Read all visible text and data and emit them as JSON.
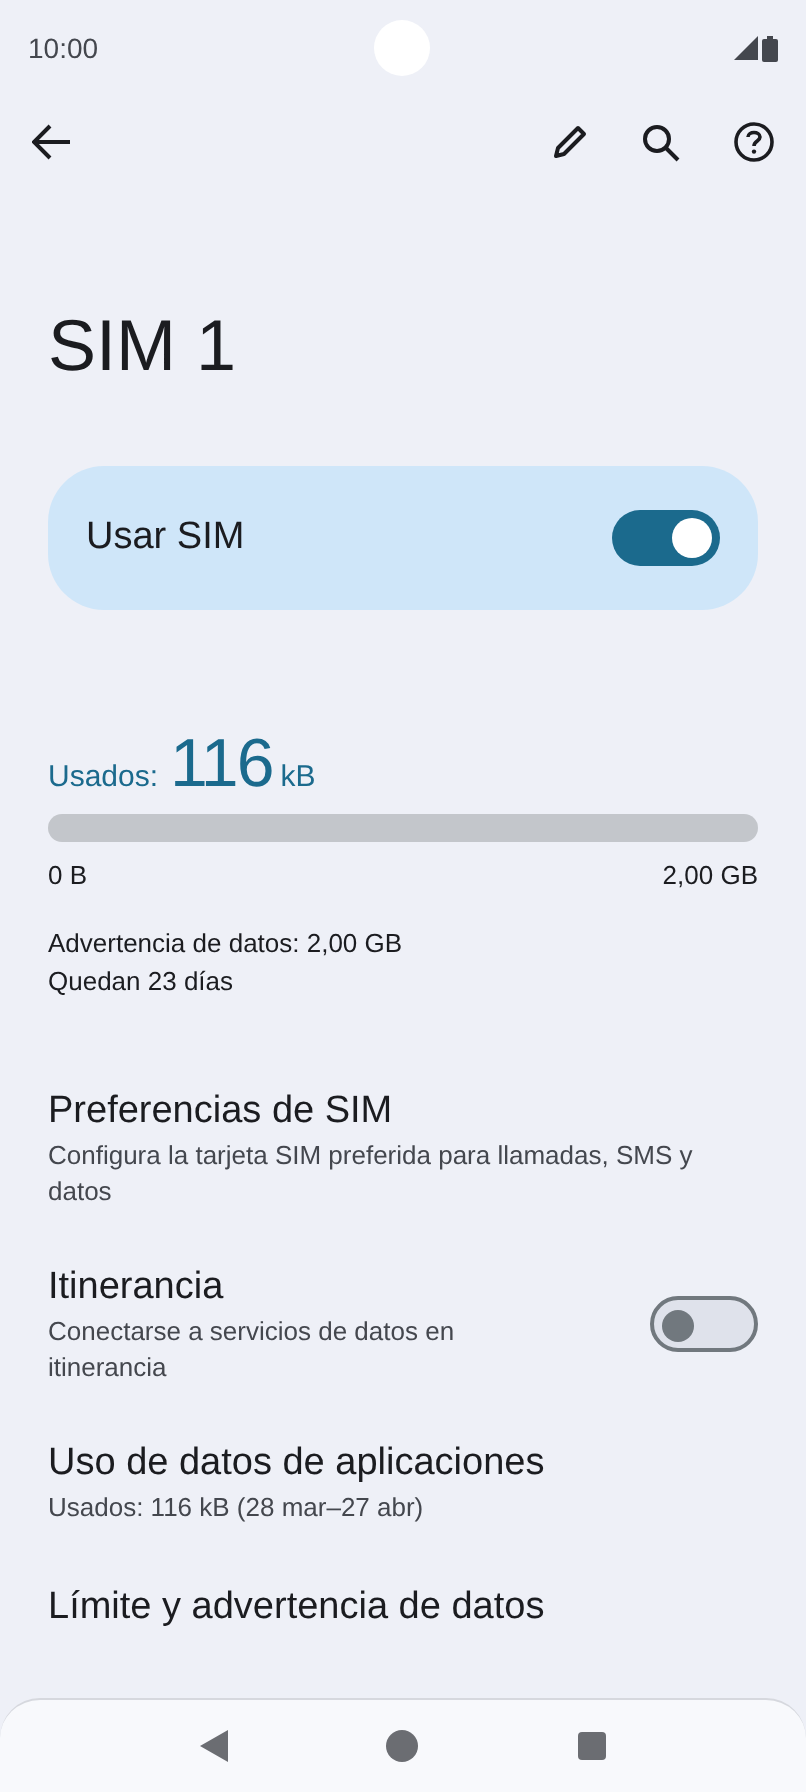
{
  "status_bar": {
    "time": "10:00"
  },
  "title": "SIM 1",
  "main_switch": {
    "label": "Usar SIM",
    "on": true
  },
  "usage": {
    "prefix": "Usados:",
    "amount": "116",
    "unit": "kB",
    "level": 0,
    "min_label": "0 B",
    "max_label": "2,00 GB",
    "warning": "Advertencia de datos: 2,00 GB",
    "days_left": "Quedan 23 días"
  },
  "settings": [
    {
      "kind": "text",
      "title": "Preferencias de SIM",
      "subtitle": "Configura la tarjeta SIM preferida para llamadas, SMS y datos"
    },
    {
      "kind": "switch",
      "title": "Itinerancia",
      "subtitle": "Conectarse a servicios de datos en itinerancia",
      "on": false
    },
    {
      "kind": "text",
      "title": "Uso de datos de aplicaciones",
      "subtitle": "Usados: 116 kB (28 mar–27 abr)"
    },
    {
      "kind": "text",
      "title": "Límite y advertencia de datos"
    }
  ]
}
